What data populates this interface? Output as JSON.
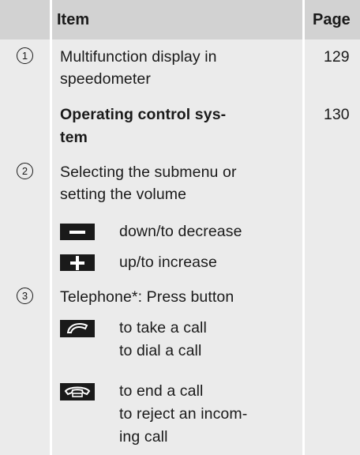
{
  "header": {
    "item": "Item",
    "page": "Page"
  },
  "rows": [
    {
      "marker": "1",
      "lines": [
        "Multifunction display in",
        "speedometer"
      ],
      "page": "129"
    },
    {
      "lines": [
        "Operating control sys-",
        "tem"
      ],
      "page": "130"
    },
    {
      "marker": "2",
      "lines": [
        "Selecting the submenu or",
        "setting the volume"
      ]
    },
    {
      "icon": "minus-key-icon",
      "lines": [
        "down/to decrease"
      ]
    },
    {
      "icon": "plus-key-icon",
      "lines": [
        "up/to increase"
      ]
    },
    {
      "marker": "3",
      "lines": [
        "Telephone*: Press button"
      ]
    },
    {
      "icon": "phone-answer-icon",
      "lines": [
        "to take a call",
        "to dial a call"
      ]
    },
    {
      "icon": "phone-hangup-icon",
      "lines": [
        "to end a call",
        "to reject an incom-",
        "ing call"
      ]
    }
  ]
}
